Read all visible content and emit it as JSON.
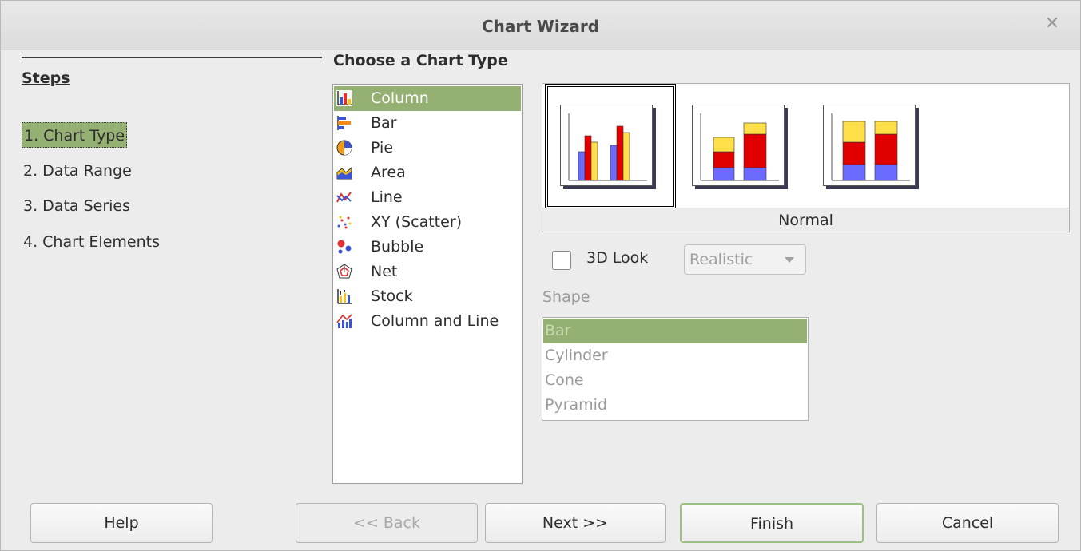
{
  "window": {
    "title": "Chart Wizard"
  },
  "steps": {
    "title": "Steps",
    "items": [
      {
        "label": "1. Chart Type"
      },
      {
        "label": "2. Data Range"
      },
      {
        "label": "3. Data Series"
      },
      {
        "label": "4. Chart Elements"
      }
    ]
  },
  "chart_types": {
    "title": "Choose a Chart Type",
    "items": [
      {
        "label": "Column",
        "icon": "column-chart-icon"
      },
      {
        "label": "Bar",
        "icon": "bar-chart-icon"
      },
      {
        "label": "Pie",
        "icon": "pie-chart-icon"
      },
      {
        "label": "Area",
        "icon": "area-chart-icon"
      },
      {
        "label": "Line",
        "icon": "line-chart-icon"
      },
      {
        "label": "XY (Scatter)",
        "icon": "scatter-chart-icon"
      },
      {
        "label": "Bubble",
        "icon": "bubble-chart-icon"
      },
      {
        "label": "Net",
        "icon": "net-chart-icon"
      },
      {
        "label": "Stock",
        "icon": "stock-chart-icon"
      },
      {
        "label": "Column and Line",
        "icon": "column-line-chart-icon"
      }
    ]
  },
  "variants": {
    "selected_label": "Normal",
    "items": [
      "normal",
      "stacked",
      "percent-stacked"
    ]
  },
  "options": {
    "look_label": "3D Look",
    "look_checked": false,
    "look_combo": "Realistic",
    "shape_label": "Shape",
    "shapes": [
      "Bar",
      "Cylinder",
      "Cone",
      "Pyramid"
    ]
  },
  "buttons": {
    "help": "Help",
    "back": "<< Back",
    "next": "Next >>",
    "finish": "Finish",
    "cancel": "Cancel"
  },
  "colors": {
    "selection": "#95b073",
    "series_blue": "#6b6bff",
    "series_red": "#e00000",
    "series_yellow": "#ffe04a"
  }
}
